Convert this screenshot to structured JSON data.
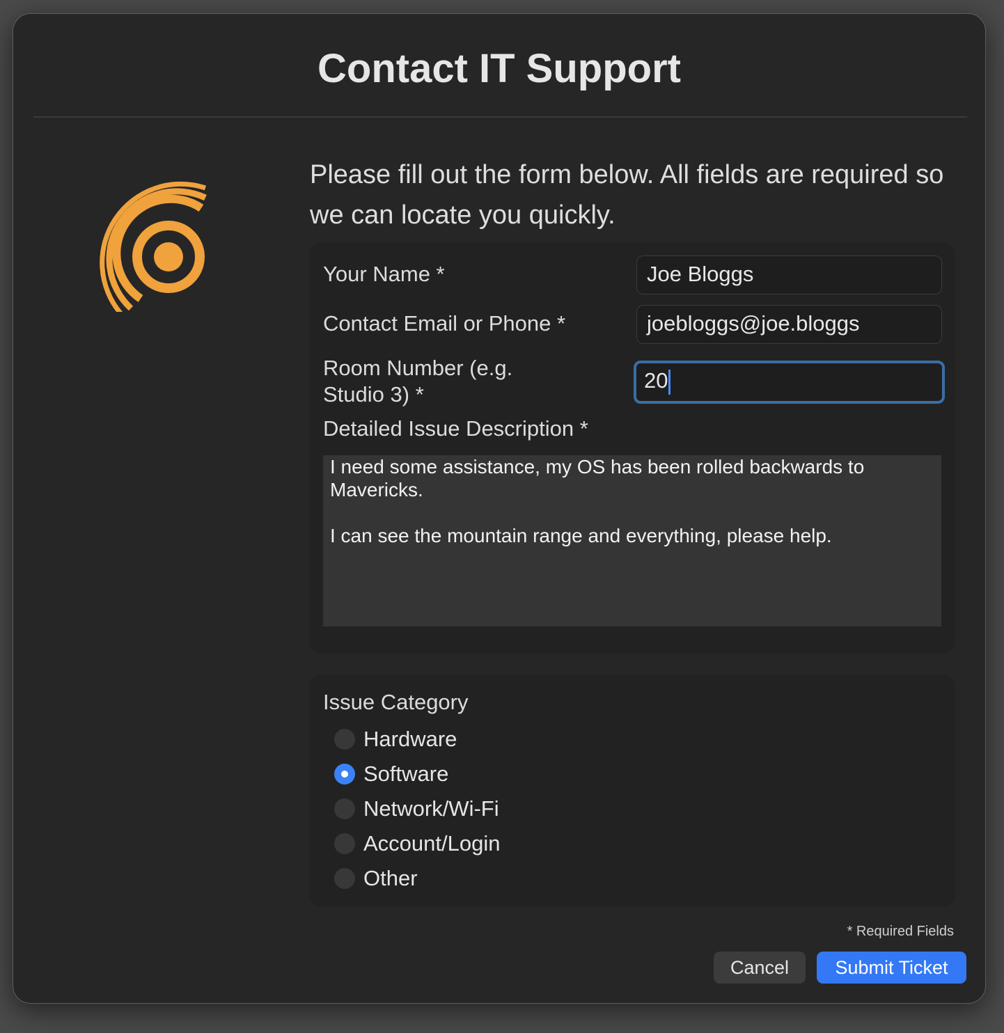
{
  "dialog": {
    "title": "Contact IT Support",
    "intro": "Please fill out the form below. All fields are required so we can locate you quickly."
  },
  "form": {
    "name_label": "Your Name *",
    "name_value": "Joe Bloggs",
    "contact_label": "Contact Email or Phone *",
    "contact_value": "joebloggs@joe.bloggs",
    "room_label_line1": "Room Number (e.g.",
    "room_label_line2": "Studio 3) *",
    "room_value": "20",
    "description_label": "Detailed Issue Description *",
    "description_value": "I need some assistance, my OS has been rolled backwards to Mavericks.\n\nI can see the mountain range and everything, please help."
  },
  "category": {
    "title": "Issue Category",
    "options": [
      "Hardware",
      "Software",
      "Network/Wi-Fi",
      "Account/Login",
      "Other"
    ],
    "selected": "Software"
  },
  "footer": {
    "required_note": "* Required Fields",
    "cancel_label": "Cancel",
    "submit_label": "Submit Ticket"
  },
  "icons": {
    "logo": "target-rings-logo-icon",
    "caret": "text-caret"
  },
  "colors": {
    "accent": "#3478f6",
    "logo": "#f0a23c",
    "window_bg": "#262626",
    "focus_ring": "#3a6ea5"
  }
}
